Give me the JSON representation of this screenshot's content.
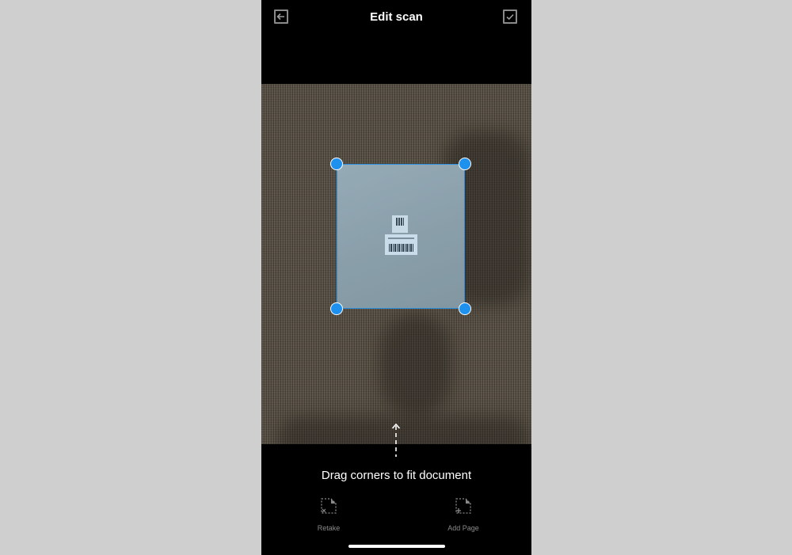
{
  "header": {
    "title": "Edit scan",
    "back_icon": "arrow-left-icon",
    "done_icon": "checkmark-icon"
  },
  "hint": {
    "text": "Drag corners to fit document",
    "icon": "dashed-arrow-up-icon"
  },
  "actions": {
    "retake_label": "Retake",
    "retake_icon": "retake-page-icon",
    "add_page_label": "Add Page",
    "add_page_icon": "add-page-icon"
  },
  "colors": {
    "accent": "#1e90ee",
    "background": "#000000",
    "secondary_text": "#8a8a8a"
  }
}
